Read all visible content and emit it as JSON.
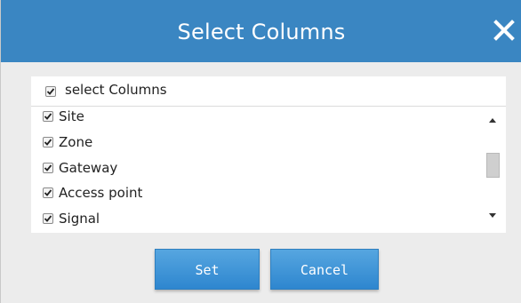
{
  "dialog": {
    "title": "Select Columns",
    "close_icon": "close-icon"
  },
  "select_all": {
    "label": "select Columns",
    "checked": true
  },
  "columns": [
    {
      "label": "Site",
      "checked": true
    },
    {
      "label": "Zone",
      "checked": true
    },
    {
      "label": "Gateway",
      "checked": true
    },
    {
      "label": "Access point",
      "checked": true
    },
    {
      "label": "Signal",
      "checked": true
    }
  ],
  "buttons": {
    "set_label": "Set",
    "cancel_label": "Cancel"
  },
  "colors": {
    "titlebar": "#3a86c2",
    "button": "#3a93d6",
    "dialog_background": "#ececec"
  }
}
